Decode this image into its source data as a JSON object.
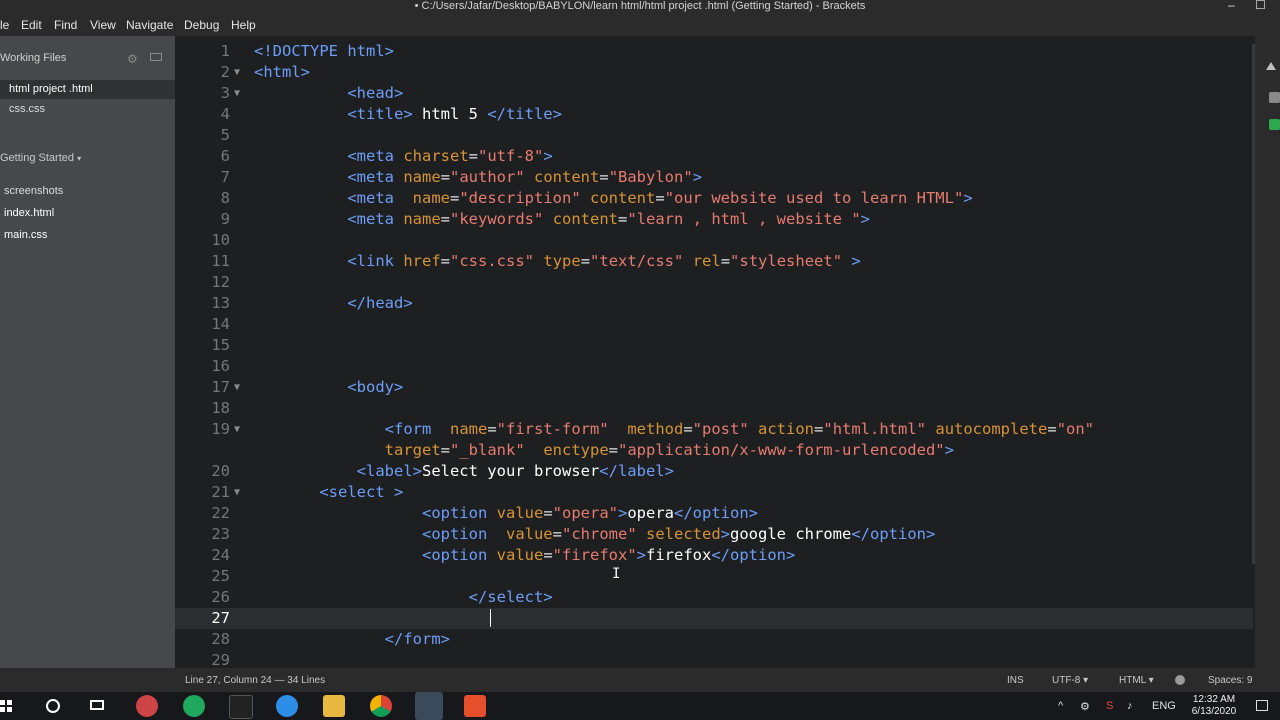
{
  "window": {
    "title": "• C:/Users/Jafar/Desktop/BABYLON/learn html/html project .html (Getting Started) - Brackets",
    "minimize": "–",
    "maximize": "☐"
  },
  "menu": {
    "file": "le",
    "edit": "Edit",
    "find": "Find",
    "view": "View",
    "navigate": "Navigate",
    "debug": "Debug",
    "help": "Help"
  },
  "sidebar": {
    "working_files_title": "Working Files",
    "working_files": [
      "html project .html",
      "css.css"
    ],
    "project_title": "Getting Started",
    "project_items": [
      "screenshots",
      "index.html",
      "main.css"
    ]
  },
  "editor": {
    "active_line": 27,
    "lines": [
      {
        "n": "1",
        "html": "<span class='t'>&lt;!DOCTYPE html&gt;</span>"
      },
      {
        "n": "2",
        "fold": true,
        "html": "<span class='t'>&lt;html&gt;</span>"
      },
      {
        "n": "3",
        "fold": true,
        "html": "          <span class='t'>&lt;head&gt;</span>"
      },
      {
        "n": "4",
        "html": "          <span class='t'>&lt;title&gt;</span><span class='x'> html 5 </span><span class='t'>&lt;/title&gt;</span>"
      },
      {
        "n": "5",
        "html": ""
      },
      {
        "n": "6",
        "html": "          <span class='t'>&lt;meta</span> <span class='a'>charset</span>=<span class='s'>\"utf-8\"</span><span class='t'>&gt;</span>"
      },
      {
        "n": "7",
        "html": "          <span class='t'>&lt;meta</span> <span class='a'>name</span>=<span class='s'>\"author\"</span> <span class='a'>content</span>=<span class='s'>\"Babylon\"</span><span class='t'>&gt;</span>"
      },
      {
        "n": "8",
        "html": "          <span class='t'>&lt;meta</span>  <span class='a'>name</span>=<span class='s'>\"description\"</span> <span class='a'>content</span>=<span class='s'>\"our website used to learn HTML\"</span><span class='t'>&gt;</span>"
      },
      {
        "n": "9",
        "html": "          <span class='t'>&lt;meta</span> <span class='a'>name</span>=<span class='s'>\"keywords\"</span> <span class='a'>content</span>=<span class='s'>\"learn , html , website \"</span><span class='t'>&gt;</span>"
      },
      {
        "n": "10",
        "html": ""
      },
      {
        "n": "11",
        "html": "          <span class='t'>&lt;link</span> <span class='a'>href</span>=<span class='s'>\"css.css\"</span> <span class='a'>type</span>=<span class='s'>\"text/css\"</span> <span class='a'>rel</span>=<span class='s'>\"stylesheet\"</span> <span class='t'>&gt;</span>"
      },
      {
        "n": "12",
        "html": ""
      },
      {
        "n": "13",
        "html": "          <span class='t'>&lt;/head&gt;</span>"
      },
      {
        "n": "14",
        "html": ""
      },
      {
        "n": "15",
        "html": ""
      },
      {
        "n": "16",
        "html": ""
      },
      {
        "n": "17",
        "fold": true,
        "html": "          <span class='t'>&lt;body&gt;</span>"
      },
      {
        "n": "18",
        "html": ""
      },
      {
        "n": "19",
        "fold": true,
        "html": "              <span class='t'>&lt;form</span>  <span class='a'>name</span>=<span class='s'>\"first-form\"</span>  <span class='a'>method</span>=<span class='s'>\"post\"</span> <span class='a'>action</span>=<span class='s'>\"html.html\"</span> <span class='a'>autocomplete</span>=<span class='s'>\"on\"</span>"
      },
      {
        "n": "",
        "html": "              <span class='a'>target</span>=<span class='s'>\"_blank\"</span>  <span class='a'>enctype</span>=<span class='s'>\"application/x-www-form-urlencoded\"</span><span class='t'>&gt;</span>"
      },
      {
        "n": "20",
        "html": "           <span class='t'>&lt;label&gt;</span><span class='x'>Select your browser</span><span class='t'>&lt;/label&gt;</span>"
      },
      {
        "n": "21",
        "fold": true,
        "html": "       <span class='t'>&lt;select</span> <span class='t'>&gt;</span>"
      },
      {
        "n": "22",
        "html": "                  <span class='t'>&lt;option</span> <span class='a'>value</span>=<span class='s'>\"opera\"</span><span class='t'>&gt;</span><span class='x'>opera</span><span class='t'>&lt;/option&gt;</span>"
      },
      {
        "n": "23",
        "html": "                  <span class='t'>&lt;option</span>  <span class='a'>value</span>=<span class='s'>\"chrome\"</span> <span class='a'>selected</span><span class='t'>&gt;</span><span class='x'>google chrome</span><span class='t'>&lt;/option&gt;</span>"
      },
      {
        "n": "24",
        "html": "                  <span class='t'>&lt;option</span> <span class='a'>value</span>=<span class='s'>\"firefox\"</span><span class='t'>&gt;</span><span class='x'>firefox</span><span class='t'>&lt;/option&gt;</span>"
      },
      {
        "n": "25",
        "html": ""
      },
      {
        "n": "26",
        "html": "                       <span class='t'>&lt;/select&gt;</span>"
      },
      {
        "n": "27",
        "html": ""
      },
      {
        "n": "28",
        "html": "              <span class='t'>&lt;/form&gt;</span>"
      },
      {
        "n": "29",
        "html": ""
      }
    ]
  },
  "status": {
    "cursor": "Line 27, Column 24 — 34 Lines",
    "mode": "INS",
    "encoding": "UTF-8",
    "encoding_arrow": "▾",
    "language": "HTML",
    "language_arrow": "▾",
    "spaces": "Spaces: 9"
  },
  "taskbar": {
    "lang": "ENG",
    "time": "12:32 AM",
    "date": "6/13/2020",
    "icon_colors": {
      "browser_blue": "#2d8ee8",
      "chrome_red": "#db4437",
      "chrome_green": "#0f9d58",
      "chrome_yellow": "#f4b400",
      "brackets_blue": "#1e6fb3",
      "sublime_orange": "#e54f2c"
    }
  }
}
